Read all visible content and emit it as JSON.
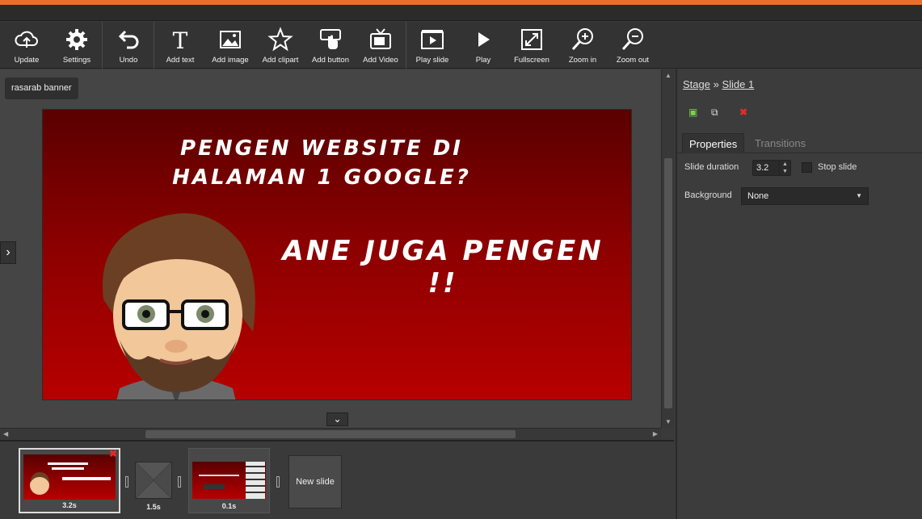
{
  "toolbar": {
    "update": "Update",
    "settings": "Settings",
    "undo": "Undo",
    "add_text": "Add text",
    "add_image": "Add image",
    "add_clipart": "Add clipart",
    "add_button": "Add button",
    "add_video": "Add Video",
    "play_slide": "Play slide",
    "play": "Play",
    "fullscreen": "Fullscreen",
    "zoom_in": "Zoom in",
    "zoom_out": "Zoom out"
  },
  "canvas": {
    "document_label": "rasarab banner",
    "slide": {
      "headline_1": "PENGEN WEBSITE DI HALAMAN 1 GOOGLE?",
      "headline_2": "ANE JUGA PENGEN !!"
    }
  },
  "panel": {
    "breadcrumb_stage": "Stage",
    "breadcrumb_sep": "»",
    "breadcrumb_slide": "Slide 1",
    "tabs": [
      {
        "label": "Properties",
        "active": true
      },
      {
        "label": "Transitions",
        "active": false
      }
    ],
    "slide_duration_label": "Slide duration",
    "slide_duration_value": "3.2",
    "stop_slide_label": "Stop slide",
    "background_label": "Background",
    "background_value": "None"
  },
  "timeline": {
    "slides": [
      {
        "duration": "3.2s",
        "selected": true
      },
      {
        "duration": "1.5s",
        "selected": false
      },
      {
        "duration": "0.1s",
        "selected": false
      }
    ],
    "new_slide": "New slide"
  },
  "colors": {
    "accent_stripe": "#e8702a",
    "slide_top": "#5a0000",
    "slide_bottom": "#b70000"
  }
}
